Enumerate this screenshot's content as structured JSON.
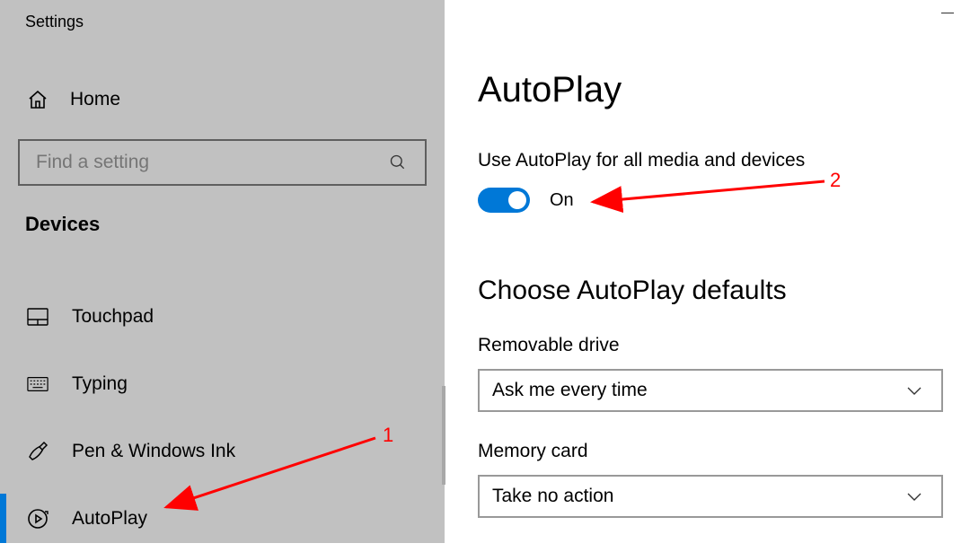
{
  "app_title": "Settings",
  "sidebar": {
    "home_label": "Home",
    "search_placeholder": "Find a setting",
    "section": "Devices",
    "items": [
      {
        "label": "Touchpad"
      },
      {
        "label": "Typing"
      },
      {
        "label": "Pen & Windows Ink"
      },
      {
        "label": "AutoPlay"
      }
    ],
    "active_index": 3
  },
  "main": {
    "title": "AutoPlay",
    "toggle_label": "Use AutoPlay for all media and devices",
    "toggle_state": "On",
    "defaults_heading": "Choose AutoPlay defaults",
    "fields": [
      {
        "label": "Removable drive",
        "value": "Ask me every time"
      },
      {
        "label": "Memory card",
        "value": "Take no action"
      }
    ]
  },
  "annotations": {
    "num1": "1",
    "num2": "2"
  },
  "colors": {
    "accent": "#0078d7",
    "annotation": "#ff0000"
  }
}
